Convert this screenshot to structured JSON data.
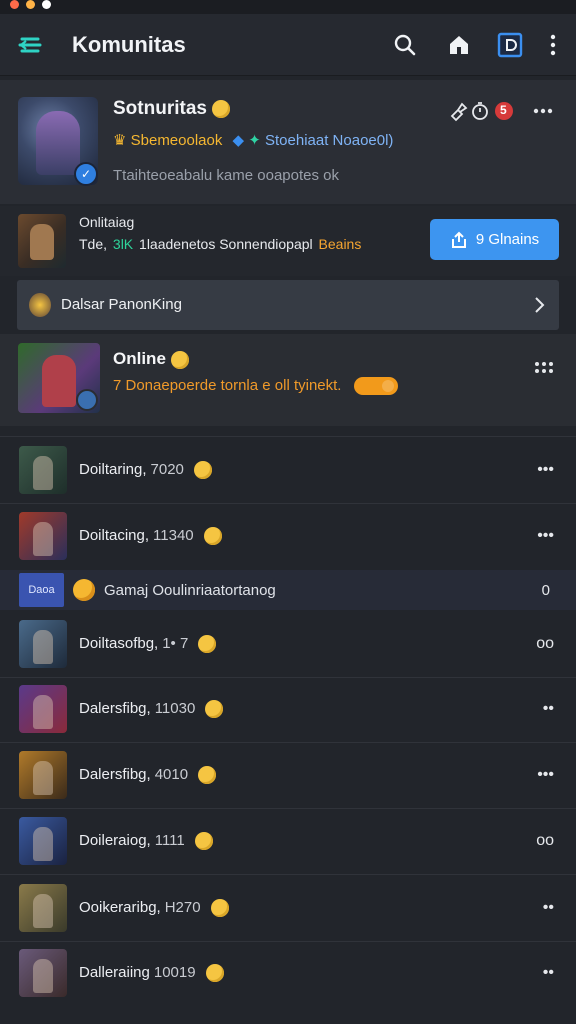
{
  "app_bar": {
    "title": "Komunitas",
    "icons": [
      "menu-back-icon",
      "search-icon",
      "home-icon",
      "square-badge-icon",
      "more-vertical-icon"
    ]
  },
  "group": {
    "name": "Sotnuritas",
    "tag1": "Sbemeoolaok",
    "tag2": "Stoehiaat Noaoe0l)",
    "description": "Ttaihteoeabalu kame ooapotes ok",
    "badge_count": "5"
  },
  "announcement": {
    "line1": "Onlitaiag",
    "line2_prefix": "Tde,",
    "line2_highlight": "3lK",
    "line2_main": "1laadenetos Sonnendiopapl",
    "line2_suffix": "Beains",
    "join_label": "9 Glnains"
  },
  "ranking": {
    "label": "Dalsar PanonKing"
  },
  "online": {
    "title": "Online",
    "subtitle": "7 Donaepoerde tornla e oll tyinekt."
  },
  "banner": {
    "tag": "Daoa",
    "text": "Gamaj Ooulinriaatortanog",
    "count": "0"
  },
  "list": [
    {
      "name": "Doiltaring,",
      "num": "7020",
      "more": "•••"
    },
    {
      "name": "Doiltacing,",
      "num": "11340",
      "more": "•••"
    },
    {
      "name": "Doiltasofbg,",
      "num": "1• 7",
      "more": "oo"
    },
    {
      "name": "Dalersfibg,",
      "num": "11030",
      "more": "••"
    },
    {
      "name": "Dalersfibg,",
      "num": "4010",
      "more": "•••"
    },
    {
      "name": "Doileraiog,",
      "num": "1111",
      "more": "oo"
    },
    {
      "name": "Ooikeraribg,",
      "num": "H270",
      "more": "••"
    },
    {
      "name": "Dalleraiing",
      "num": "10019",
      "more": "••"
    }
  ],
  "colors": {
    "accent_blue": "#3d95f0",
    "accent_orange": "#f09a2a",
    "accent_teal": "#2fd3c4",
    "badge_red": "#d63a3a"
  }
}
